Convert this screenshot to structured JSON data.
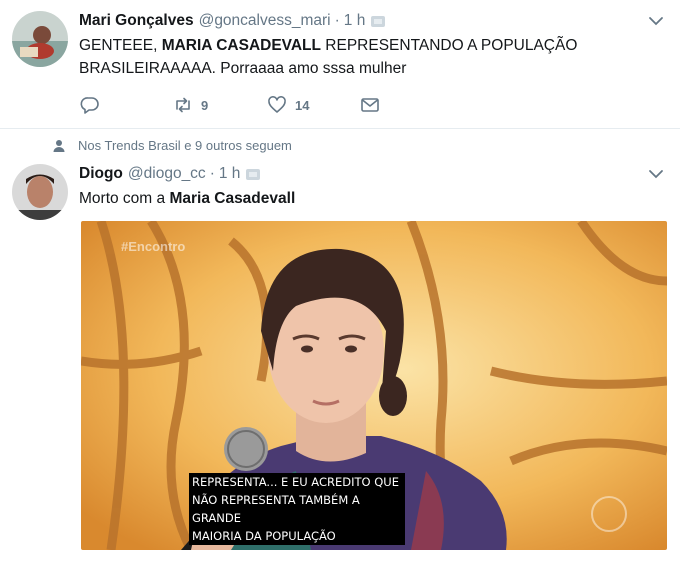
{
  "tweets": [
    {
      "name": "Mari Gonçalves",
      "handle": "@goncalvess_mari",
      "separator": "·",
      "time": "1 h",
      "text_parts": [
        "GENTEEE, ",
        "MARIA CASADEVALL",
        " REPRESENTANDO A POPULAÇÃO BRASILEIRAAAAA. Porraaaa amo sssa mulher"
      ],
      "actions": {
        "reply_icon": "reply-icon",
        "retweet_icon": "retweet-icon",
        "retweet_count": "9",
        "like_icon": "heart-icon",
        "like_count": "14",
        "dm_icon": "envelope-icon"
      }
    },
    {
      "context": "Nos Trends Brasil e 9 outros seguem",
      "name": "Diogo",
      "handle": "@diogo_cc",
      "separator": "·",
      "time": "1 h",
      "text_parts": [
        "Morto com a ",
        "Maria Casadevall"
      ],
      "media": {
        "tv_tag": "#Encontro",
        "subtitle_lines": [
          "REPRESENTA... E EU ACREDITO QUE",
          "NÃO REPRESENTA TAMBÉM A GRANDE",
          "MAIORIA DA POPULAÇÃO"
        ]
      }
    }
  ],
  "colors": {
    "text": "#14171a",
    "secondary": "#657786",
    "divider": "#e6ecf0",
    "background": "#ffffff"
  }
}
